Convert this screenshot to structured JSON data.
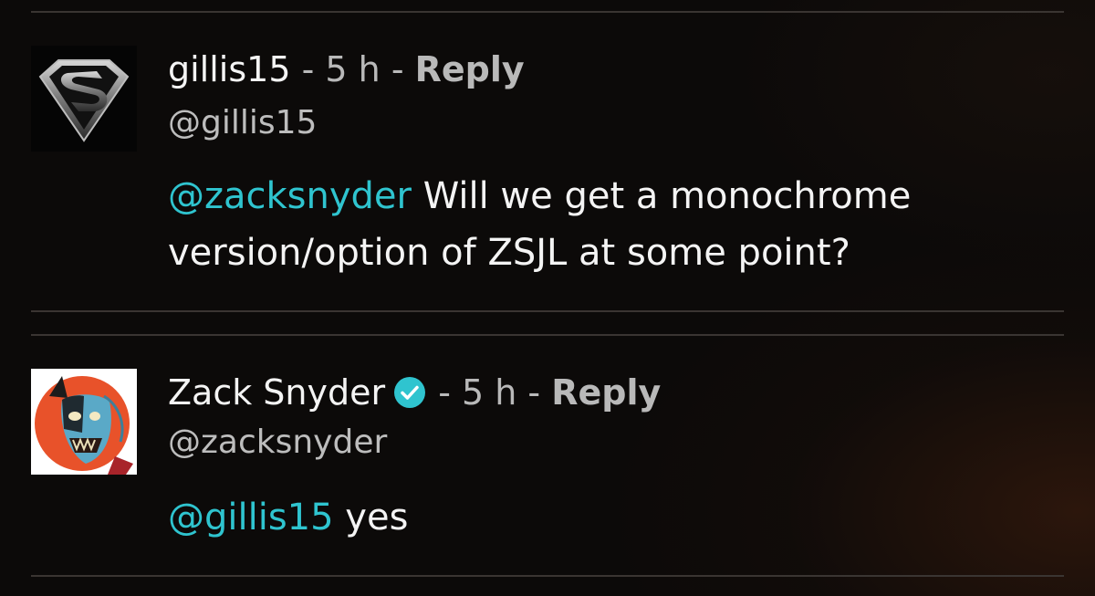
{
  "comments": [
    {
      "author": "gillis15",
      "separator1": " - ",
      "time": "5 h",
      "separator2": " - ",
      "reply_label": "Reply",
      "handle": "@gillis15",
      "mention": "@zacksnyder",
      "text": " Will we get a monochrome version/option of ZSJL at some point?",
      "avatar_icon": "superman-logo-icon"
    },
    {
      "author": "Zack Snyder",
      "verified": true,
      "separator1": " - ",
      "time": "5 h",
      "separator2": " - ",
      "reply_label": "Reply",
      "handle": "@zacksnyder",
      "mention": "@gillis15",
      "text": " yes",
      "avatar_icon": "zombie-batman-art-icon"
    }
  ],
  "colors": {
    "mention": "#2fc4cf",
    "verified_badge": "#2fc4cf",
    "background": "#0c0a09",
    "divider": "#3a3532"
  }
}
